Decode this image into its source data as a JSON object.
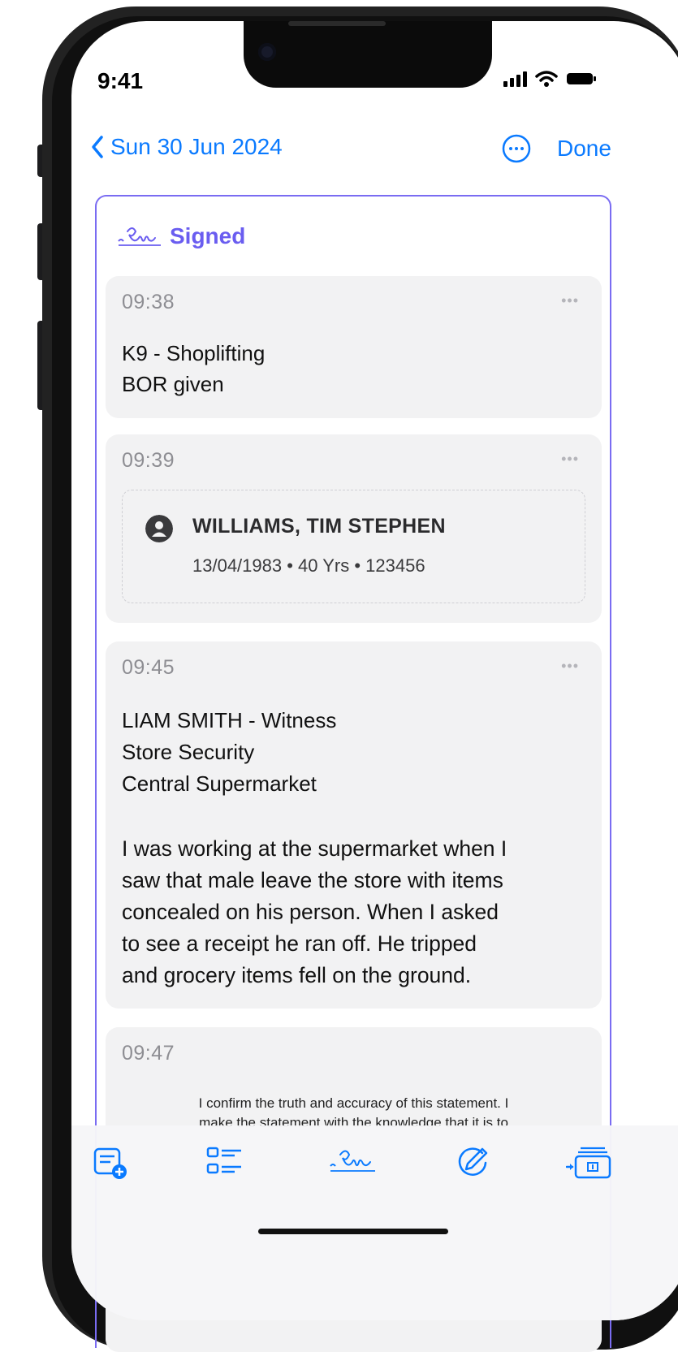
{
  "status_bar": {
    "time": "9:41"
  },
  "nav": {
    "back_label": "Sun 30 Jun 2024",
    "done_label": "Done"
  },
  "section": {
    "status_label": "Signed"
  },
  "entries": [
    {
      "time": "09:38",
      "text_lines": [
        "K9 - Shoplifting",
        "BOR given"
      ]
    },
    {
      "time": "09:39",
      "person": {
        "name": "WILLIAMS, TIM STEPHEN",
        "details": "13/04/1983 • 40 Yrs • 123456"
      }
    },
    {
      "time": "09:45",
      "header_lines": [
        "LIAM SMITH - Witness",
        "Store Security",
        "Central Supermarket"
      ],
      "statement": "I was working at the supermarket when I\nsaw that male leave the store with items\nconcealed on his person. When I asked\nto see a receipt he ran off. He tripped\nand  grocery items fell on the ground."
    },
    {
      "time": "09:47",
      "confirm_line1": "I confirm the truth and accuracy of this statement. I",
      "confirm_line2": "make the statement with the knowledge that it is to"
    }
  ],
  "toolbar": {
    "icons": [
      "note-add-icon",
      "checklist-icon",
      "signature-icon",
      "pencil-circle-icon",
      "id-card-import-icon"
    ]
  },
  "colors": {
    "accent": "#0a7aff",
    "signed": "#6a5df0",
    "card_bg": "#f2f2f3"
  }
}
